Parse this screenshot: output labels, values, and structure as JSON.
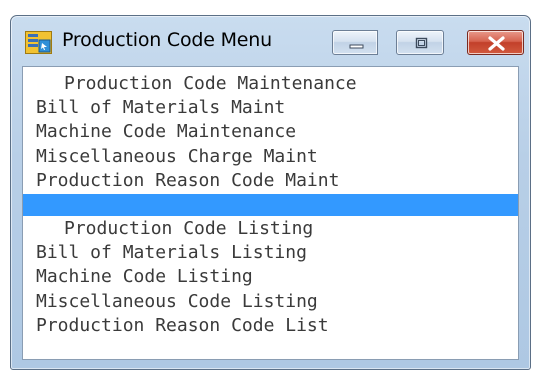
{
  "window": {
    "title": "Production Code Menu",
    "controls": {
      "minimize_icon": "minimize-icon",
      "maximize_icon": "maximize-icon",
      "close_icon": "close-icon"
    }
  },
  "menu": {
    "items": [
      {
        "label": "Production Code Maintenance",
        "type": "header"
      },
      {
        "label": "Bill of Materials Maint",
        "type": "item"
      },
      {
        "label": "Machine Code Maintenance",
        "type": "item"
      },
      {
        "label": "Miscellaneous Charge Maint",
        "type": "item"
      },
      {
        "label": "Production Reason Code Maint",
        "type": "item"
      },
      {
        "label": "",
        "type": "separator-selected"
      },
      {
        "label": "Production Code Listing",
        "type": "header"
      },
      {
        "label": "Bill of Materials Listing",
        "type": "item"
      },
      {
        "label": "Machine Code Listing",
        "type": "item"
      },
      {
        "label": "Miscellaneous Code Listing",
        "type": "item"
      },
      {
        "label": "Production Reason Code List",
        "type": "item"
      }
    ]
  },
  "colors": {
    "selection": "#3399ff",
    "text": "#3a3a3a",
    "close_button": "#c2402a"
  }
}
